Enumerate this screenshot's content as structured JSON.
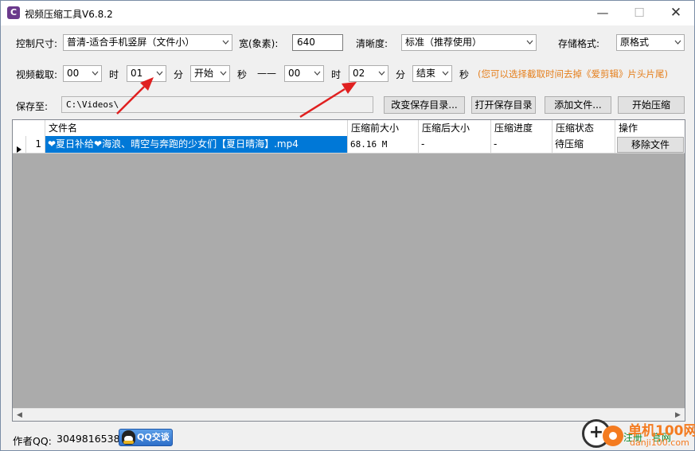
{
  "window": {
    "title": "视频压缩工具V6.8.2",
    "controls": {
      "minimize": "—",
      "maximize": "☐",
      "close": "✕"
    }
  },
  "row1": {
    "size_label": "控制尺寸:",
    "size_value": "普清-适合手机竖屏（文件小）",
    "width_label": "宽(象素):",
    "width_value": "640",
    "clarity_label": "清晰度:",
    "clarity_value": "标准（推荐使用）",
    "format_label": "存储格式:",
    "format_value": "原格式"
  },
  "row2": {
    "clip_label": "视频截取:",
    "start_hour": "00",
    "hour_label": "时",
    "start_minute": "01",
    "minute_label": "分",
    "start_second": "开始",
    "second_label": "秒",
    "separator": "——",
    "end_hour": "00",
    "end_hour_label": "时",
    "end_minute": "02",
    "end_minute_label": "分",
    "end_second": "结束",
    "end_second_label": "秒",
    "hint": "(您可以选择截取时间去掉《爱剪辑》片头片尾)"
  },
  "row3": {
    "save_label": "保存至:",
    "save_path": "C:\\Videos\\",
    "change_dir_button": "改变保存目录...",
    "open_dir_button": "打开保存目录",
    "add_file_button": "添加文件...",
    "start_button": "开始压缩"
  },
  "table": {
    "columns": [
      "文件名",
      "压缩前大小",
      "压缩后大小",
      "压缩进度",
      "压缩状态",
      "操作"
    ],
    "rows": [
      {
        "index": "1",
        "filename": "❤夏日补给❤海浪、晴空与奔跑的少女们【夏日晴海】.mp4",
        "size_before": "68.16 M",
        "size_after": "-",
        "progress": "-",
        "status": "待压缩",
        "action": "移除文件"
      }
    ]
  },
  "footer": {
    "author_label": "作者QQ:",
    "author_qq": "3049816538",
    "qq_badge": "QQ交谈",
    "register_link": "注册",
    "website_link": "官网"
  },
  "watermark": {
    "brand": "单机100网",
    "domain": "danji100.com"
  },
  "colors": {
    "selection": "#0078d7",
    "hint": "#e57f1c",
    "arrow": "#e02020"
  }
}
